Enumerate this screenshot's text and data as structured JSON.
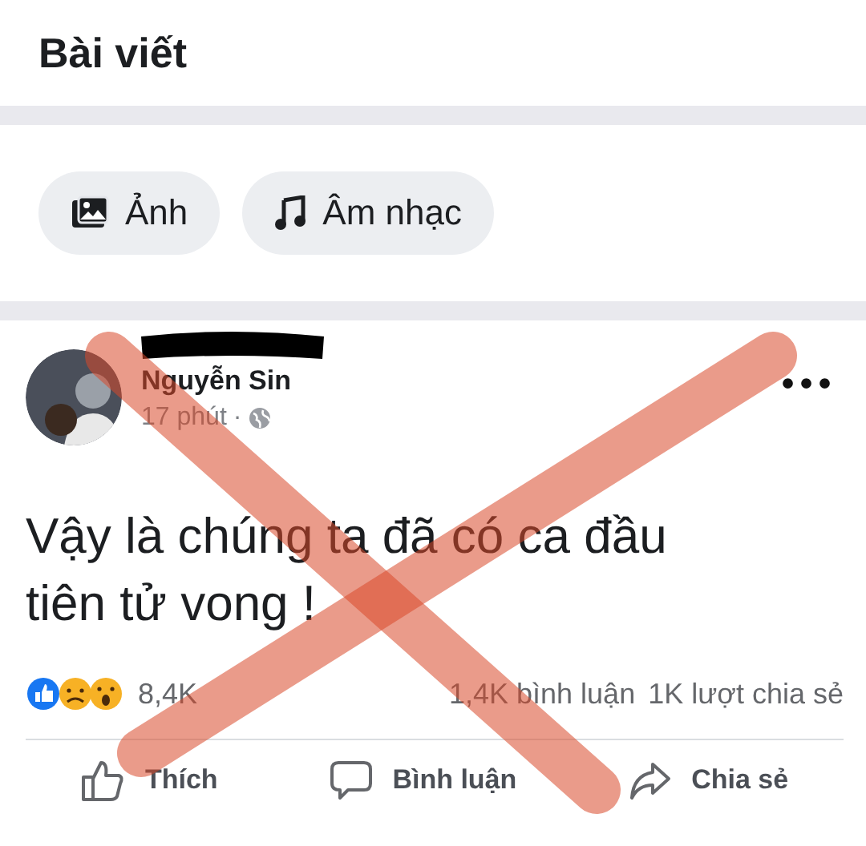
{
  "header": {
    "title": "Bài viết"
  },
  "filters": [
    {
      "kind": "photo",
      "label": "Ảnh"
    },
    {
      "kind": "music",
      "label": "Âm nhạc"
    }
  ],
  "post": {
    "author": "Nguyễn Sin",
    "time": "17 phút",
    "separator": "·",
    "menu": "•••",
    "text": "Vậy là chúng ta đã có ca đầu tiên tử vong !",
    "reactions": "8,4K",
    "comments": "1,4K bình luận",
    "shares": "1K lượt chia sẻ",
    "actions": [
      {
        "kind": "like",
        "label": "Thích"
      },
      {
        "kind": "comment",
        "label": "Bình luận"
      },
      {
        "kind": "share",
        "label": "Chia sẻ"
      }
    ]
  }
}
